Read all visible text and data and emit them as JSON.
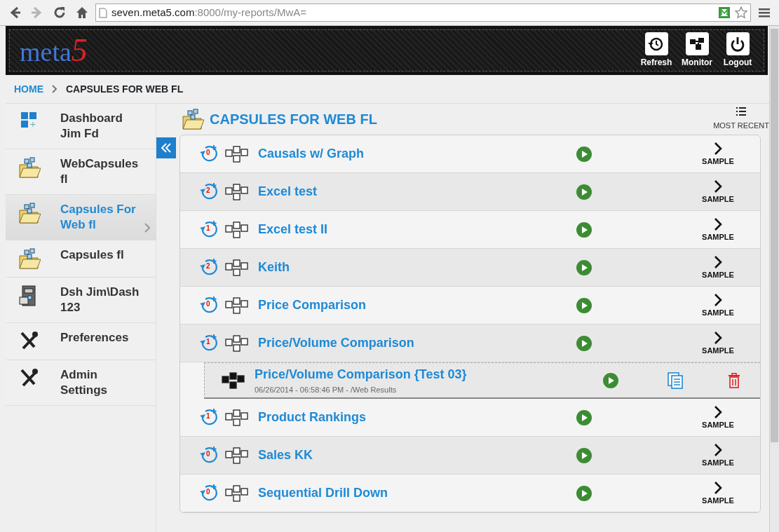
{
  "browser": {
    "nav": [
      {
        "kind": "back",
        "disabled": false
      },
      {
        "kind": "forward",
        "disabled": true
      },
      {
        "kind": "reload",
        "disabled": false
      },
      {
        "kind": "home",
        "disabled": false
      }
    ],
    "url_host": "seven.meta5.com",
    "url_rest": ":8000/my-reports/MwA="
  },
  "header": {
    "logo": {
      "text": "meta",
      "accent": "5"
    },
    "actions": [
      {
        "kind": "refresh",
        "label": "Refresh"
      },
      {
        "kind": "monitor",
        "label": "Monitor"
      },
      {
        "kind": "logout",
        "label": "Logout"
      }
    ]
  },
  "breadcrumb": [
    {
      "kind": "link",
      "label": "HOME"
    },
    {
      "kind": "current",
      "label": "CAPSULES FOR WEB FL"
    }
  ],
  "sidebar": {
    "items": [
      {
        "kind": "dashboard",
        "label": "Dashboard Jim Fd",
        "selected": false
      },
      {
        "kind": "folder",
        "label": "WebCapsules fl",
        "selected": false
      },
      {
        "kind": "folder",
        "label": "Capsules For Web fl",
        "selected": true
      },
      {
        "kind": "folder",
        "label": "Capsules fl",
        "selected": false
      },
      {
        "kind": "cabinet",
        "label": "Dsh Jim\\Dash 123",
        "selected": false
      },
      {
        "kind": "tools",
        "label": "Preferences",
        "selected": false
      },
      {
        "kind": "tools",
        "label": "Admin Settings",
        "selected": false
      }
    ]
  },
  "main": {
    "title": "CAPSULES FOR WEB FL",
    "sort_label": "MOST RECENT",
    "reports": [
      {
        "name": "Causals w/ Graph",
        "count": "0",
        "action": "SAMPLE"
      },
      {
        "name": "Excel test",
        "count": "2",
        "action": "SAMPLE"
      },
      {
        "name": "Excel test II",
        "count": "1",
        "action": "SAMPLE"
      },
      {
        "name": "Keith",
        "count": "2",
        "action": "SAMPLE"
      },
      {
        "name": "Price Comparison",
        "count": "0",
        "action": "SAMPLE"
      },
      {
        "name": "Price/Volume Comparison",
        "count": "1",
        "action": "SAMPLE",
        "children": [
          {
            "name": "Price/Volume Comparison {Test 03}",
            "meta": "06/26/2014 - 06:58:46 PM - /Web Results"
          }
        ]
      },
      {
        "name": "Product Rankings",
        "count": "1",
        "action": "SAMPLE"
      },
      {
        "name": "Sales KK",
        "count": "0",
        "action": "SAMPLE"
      },
      {
        "name": "Sequential Drill Down",
        "count": "0",
        "action": "SAMPLE"
      }
    ]
  }
}
